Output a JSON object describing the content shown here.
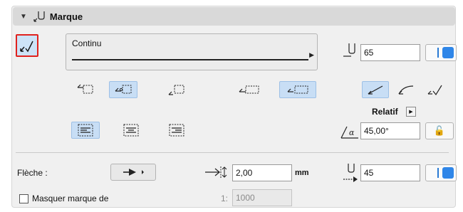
{
  "header": {
    "title": "Marque",
    "collapse_icon": "triangle-down-icon",
    "section_icon": "marker-icon"
  },
  "line_type": {
    "label": "Continu"
  },
  "marker_pen": {
    "value": "65"
  },
  "relative": {
    "label": "Relatif"
  },
  "angle": {
    "value": "45,00°",
    "symbol": "α"
  },
  "arrow": {
    "label": "Flèche :"
  },
  "size": {
    "value": "2,00",
    "unit": "mm"
  },
  "arrow_pen": {
    "value": "45"
  },
  "hide_marker": {
    "label": "Masquer marque de",
    "scale_prefix": "1:",
    "scale_value": "1000",
    "checked": false
  },
  "colors": {
    "accent": "#2f86e8",
    "selected_bg": "#c8def5",
    "highlight_border": "#e0221e"
  }
}
